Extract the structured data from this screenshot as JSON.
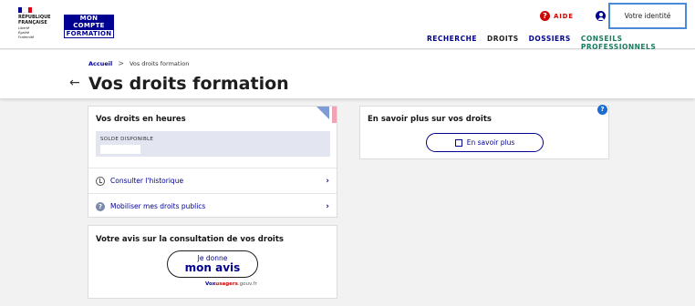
{
  "header": {
    "republique": [
      "RÉPUBLIQUE",
      "FRANÇAISE"
    ],
    "motto": [
      "Liberté",
      "Égalité",
      "Fraternité"
    ],
    "brand": [
      "MON",
      "COMPTE",
      "FORMATION"
    ],
    "flag_colors": [
      "#000091",
      "#ffffff",
      "#e1000f"
    ],
    "aide_label": "AIDE",
    "identity_label": "Votre identité",
    "nav": [
      "RECHERCHE",
      "DROITS",
      "DOSSIERS",
      "CONSEILS PROFESSIONNELS"
    ],
    "nav_active": "DROITS"
  },
  "breadcrumb": {
    "home": "Accueil",
    "separator": ">",
    "current": "Vos droits formation"
  },
  "page": {
    "back_icon": "arrow-left-icon",
    "title": "Vos droits formation"
  },
  "rights_card": {
    "title": "Vos droits en heures",
    "balance_label": "SOLDE DISPONIBLE",
    "balance_value": "",
    "rows": [
      {
        "icon": "history-icon",
        "label": "Consulter l'historique"
      },
      {
        "icon": "question-icon",
        "label": "Mobiliser mes droits publics"
      }
    ]
  },
  "info_card": {
    "title": "En savoir plus sur vos droits",
    "button_label": "En savoir plus"
  },
  "feedback_card": {
    "title": "Votre avis sur la consultation de vos droits",
    "button_line1": "Je donne",
    "button_line2": "mon avis",
    "vox_bold": "Vox",
    "vox_red": "usagers",
    "vox_rest": ".gouv.fr"
  },
  "colors": {
    "primary": "#000091",
    "danger": "#ce0500",
    "accent_green": "#1a7a5e"
  }
}
